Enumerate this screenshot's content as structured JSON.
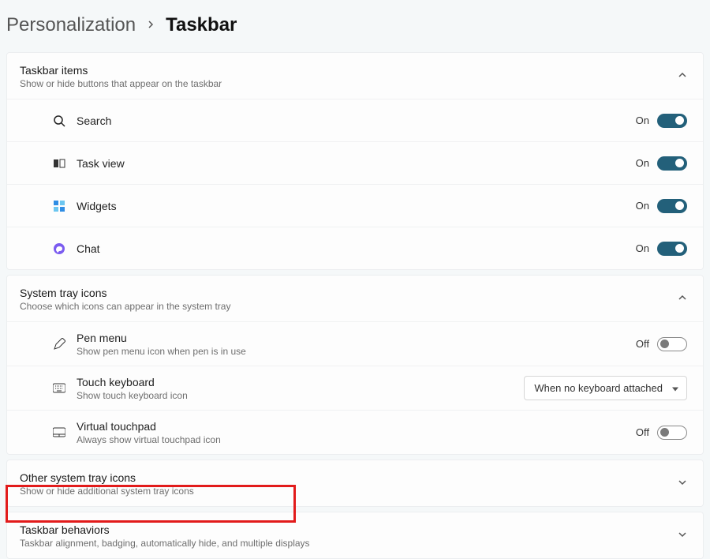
{
  "breadcrumb": {
    "parent": "Personalization",
    "current": "Taskbar"
  },
  "sections": {
    "taskbar_items": {
      "title": "Taskbar items",
      "sub": "Show or hide buttons that appear on the taskbar",
      "rows": [
        {
          "label": "Search",
          "state": "On"
        },
        {
          "label": "Task view",
          "state": "On"
        },
        {
          "label": "Widgets",
          "state": "On"
        },
        {
          "label": "Chat",
          "state": "On"
        }
      ]
    },
    "system_tray": {
      "title": "System tray icons",
      "sub": "Choose which icons can appear in the system tray",
      "pen": {
        "label": "Pen menu",
        "sub": "Show pen menu icon when pen is in use",
        "state": "Off"
      },
      "kbd": {
        "label": "Touch keyboard",
        "sub": "Show touch keyboard icon",
        "value": "When no keyboard attached"
      },
      "vtp": {
        "label": "Virtual touchpad",
        "sub": "Always show virtual touchpad icon",
        "state": "Off"
      }
    },
    "other_tray": {
      "title": "Other system tray icons",
      "sub": "Show or hide additional system tray icons"
    },
    "behaviors": {
      "title": "Taskbar behaviors",
      "sub": "Taskbar alignment, badging, automatically hide, and multiple displays"
    }
  }
}
